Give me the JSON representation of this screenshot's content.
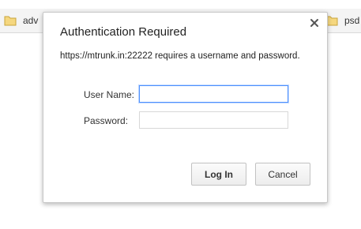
{
  "bookmarks": [
    {
      "label": "adv",
      "icon": "folder-icon"
    },
    {
      "label": "psd",
      "icon": "folder-icon"
    }
  ],
  "dialog": {
    "title": "Authentication Required",
    "message": "https://mtrunk.in:22222 requires a username and password.",
    "close_icon": "close-icon",
    "username_label": "User Name:",
    "username_value": "",
    "password_label": "Password:",
    "password_value": "",
    "login_label": "Log In",
    "cancel_label": "Cancel"
  },
  "colors": {
    "focus_ring": "#4d90fe",
    "folder": "#f5d77f"
  }
}
